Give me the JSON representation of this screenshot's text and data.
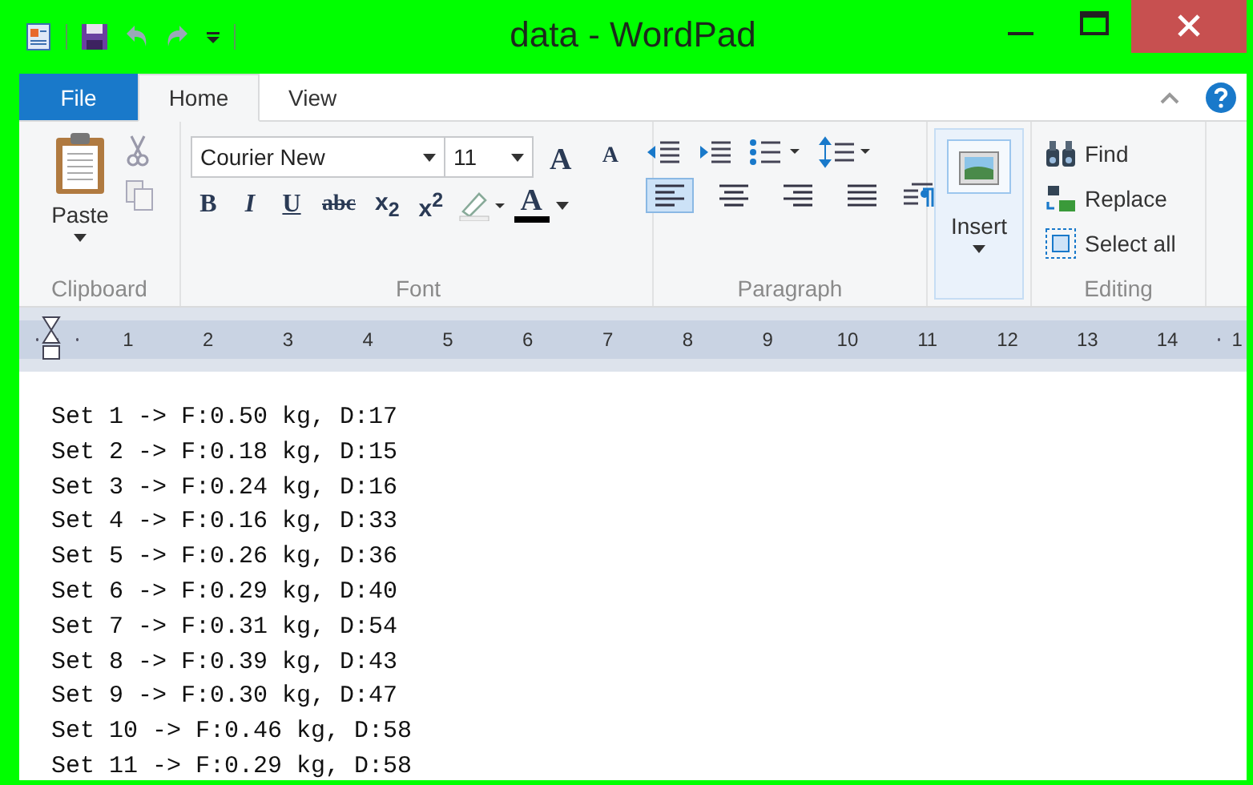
{
  "window": {
    "title": "data - WordPad"
  },
  "tabs": [
    {
      "label": "File",
      "kind": "file",
      "selected": false
    },
    {
      "label": "Home",
      "kind": "tab",
      "selected": true
    },
    {
      "label": "View",
      "kind": "tab",
      "selected": false
    }
  ],
  "clipboard": {
    "paste": "Paste",
    "group": "Clipboard"
  },
  "font": {
    "family": "Courier New",
    "size": "11",
    "grow": "A",
    "shrink": "A",
    "group": "Font",
    "formats": [
      {
        "kind": "bold",
        "label": "B"
      },
      {
        "kind": "italic",
        "label": "I"
      },
      {
        "kind": "underline",
        "label": "U"
      },
      {
        "kind": "strike",
        "label": "abc"
      },
      {
        "kind": "sub",
        "label": "x$_{2}$"
      },
      {
        "kind": "sup",
        "label": "x$^{2}$"
      }
    ],
    "color_label": "A"
  },
  "paragraph": {
    "group": "Paragraph",
    "align": [
      {
        "kind": "left",
        "selected": true
      },
      {
        "kind": "center",
        "selected": false
      },
      {
        "kind": "right",
        "selected": false
      },
      {
        "kind": "justify",
        "selected": false
      }
    ]
  },
  "insert": {
    "label": "Insert"
  },
  "editing": {
    "group": "Editing",
    "items": [
      {
        "kind": "find",
        "label": "Find"
      },
      {
        "kind": "replace",
        "label": "Replace"
      },
      {
        "kind": "selectall",
        "label": "Select all"
      }
    ]
  },
  "ruler": [
    "1",
    "2",
    "3",
    "4",
    "5",
    "6",
    "7",
    "8",
    "9",
    "10",
    "11",
    "12",
    "13",
    "14",
    "1"
  ],
  "document": {
    "lines": [
      "Set 1 -> F:0.50 kg, D:17",
      "Set 2 -> F:0.18 kg, D:15",
      "Set 3 -> F:0.24 kg, D:16",
      "Set 4 -> F:0.16 kg, D:33",
      "Set 5 -> F:0.26 kg, D:36",
      "Set 6 -> F:0.29 kg, D:40",
      "Set 7 -> F:0.31 kg, D:54",
      "Set 8 -> F:0.39 kg, D:43",
      "Set 9 -> F:0.30 kg, D:47",
      "Set 10 -> F:0.46 kg, D:58",
      "Set 11 -> F:0.29 kg, D:58"
    ]
  }
}
